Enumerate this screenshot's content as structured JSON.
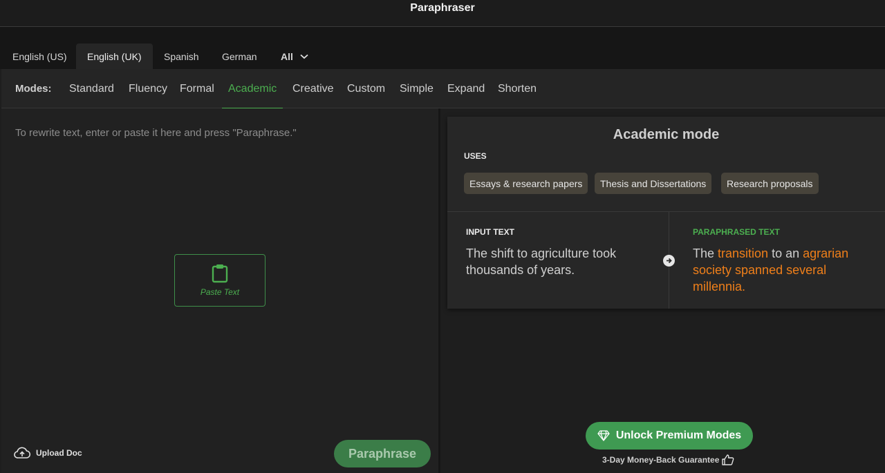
{
  "app": {
    "title": "Paraphraser"
  },
  "languages": {
    "tabs": [
      {
        "label": "English (US)"
      },
      {
        "label": "English (UK)",
        "active": true
      },
      {
        "label": "Spanish"
      },
      {
        "label": "German"
      },
      {
        "label": "All"
      }
    ]
  },
  "modes": {
    "label": "Modes:",
    "items": [
      {
        "label": "Standard"
      },
      {
        "label": "Fluency"
      },
      {
        "label": "Formal"
      },
      {
        "label": "Academic",
        "active": true
      },
      {
        "label": "Creative"
      },
      {
        "label": "Custom"
      },
      {
        "label": "Simple"
      },
      {
        "label": "Expand"
      },
      {
        "label": "Shorten"
      }
    ]
  },
  "editor": {
    "placeholder": "To rewrite text, enter or paste it here and press \"Paraphrase.\"",
    "paste_label": "Paste Text",
    "upload_label": "Upload Doc",
    "paraphrase_label": "Paraphrase"
  },
  "mode_card": {
    "title": "Academic mode",
    "uses_label": "USES",
    "uses": [
      "Essays & research papers",
      "Thesis and Dissertations",
      "Research proposals"
    ],
    "input_heading": "INPUT TEXT",
    "input_text": "The shift to agriculture took thousands of years.",
    "output_heading": "PARAPHRASED TEXT",
    "output_parts": [
      "The ",
      "transition",
      " to an ",
      "agrarian society spanned several millennia."
    ]
  },
  "premium": {
    "button_label": "Unlock Premium Modes",
    "guarantee": "3-Day Money-Back Guarantee"
  },
  "colors": {
    "accent_green": "#4caf50",
    "highlight_orange": "#ef7f1a",
    "chip_bg": "#47433a"
  }
}
